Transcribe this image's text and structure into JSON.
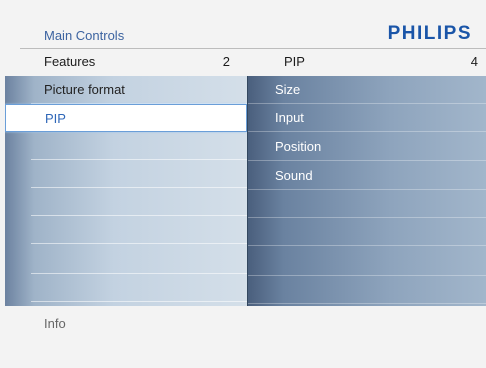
{
  "header": {
    "title": "Main Controls",
    "brand": "PHILIPS"
  },
  "columns": {
    "left": {
      "label": "Features",
      "count": "2"
    },
    "right": {
      "label": "PIP",
      "count": "4"
    }
  },
  "left_menu": {
    "items": [
      {
        "label": "Picture format"
      },
      {
        "label": "PIP"
      }
    ]
  },
  "right_menu": {
    "items": [
      {
        "label": "Size"
      },
      {
        "label": "Input"
      },
      {
        "label": "Position"
      },
      {
        "label": "Sound"
      }
    ]
  },
  "footer": {
    "info_label": "Info"
  },
  "colors": {
    "brand": "#1a55a8",
    "title": "#3c63a0",
    "selection_text": "#2f67b8"
  }
}
